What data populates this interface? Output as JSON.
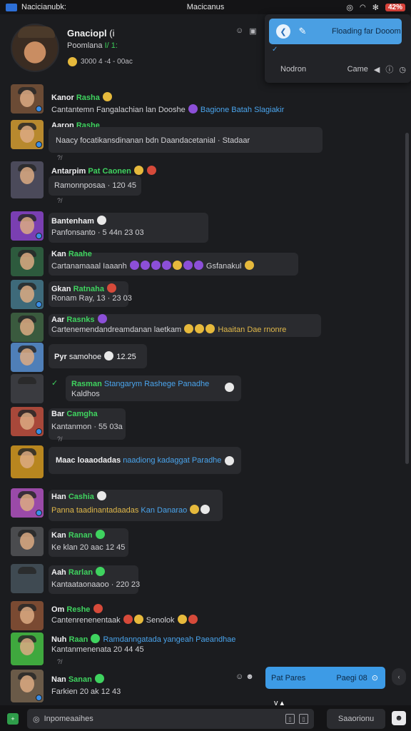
{
  "status": {
    "left_text": "Nacicianubk:",
    "center_text": "Macicanus",
    "battery": "42%"
  },
  "header": {
    "name": "Gnaciopl",
    "name_suffix": "(i",
    "subtitle": "Poomlana",
    "subtitle_status": "I/ 1:",
    "meta": "3000 4 -4 - 00ac"
  },
  "popover": {
    "bar_label": "Floading far Dooom",
    "left_label": "Nodron",
    "right_label": "Came"
  },
  "messages": [
    {
      "name": "Kanor",
      "tag": "Rasha",
      "text": "Cantantemn Fangalachian lan Dooshe",
      "text_accent": "Bagione Batah  Slagiakir"
    },
    {
      "name": "Aaron",
      "tag": "Rashe",
      "text": "Naacy focatikansdinanan bdn Daandacetanial · Stadaar",
      "sub": "?/"
    },
    {
      "name": "Antarpim",
      "tag": "Pat Caonen",
      "text": "Ramonnposaa · 120 45",
      "sub": "?/"
    },
    {
      "name": "Bantenham",
      "tag": "",
      "text": "Panfonsanto · 5 44n 23 03"
    },
    {
      "name": "Kan",
      "tag": "Raahe",
      "text": "Cartanamaaal Iaaanh",
      "text_accent": "Gsfanakul"
    },
    {
      "name": "Gkan",
      "tag": "Ratnaha",
      "text": "Ronam Ray, 13 · 23 03"
    },
    {
      "name": "Aar",
      "tag": "Rasnks",
      "text": "Cartenemendandreamdanan laetkam",
      "text_accent": "Haaitan Dae  rnonre"
    },
    {
      "name": "Pyr",
      "tag": "samohoe",
      "text": "12.25"
    },
    {
      "name": "Rasman",
      "tag": "Stangarym Rashege Panadhe",
      "text": "Kaldhos"
    },
    {
      "name": "Bar",
      "tag": "Camgha",
      "text": "Kantanmon · 55 03a",
      "sub": "?/"
    },
    {
      "name": "Maac",
      "tag": "loaaodadas",
      "text": "",
      "text_accent": "naadiong kadaggat Paradhe"
    },
    {
      "name": "Han",
      "tag": "Cashia",
      "text": "Panna taadinantadaadas",
      "text_accent": "Kan  Danarao"
    },
    {
      "name": "Kan",
      "tag": "Ranan",
      "text": "Ke klan 20 aac 12 45"
    },
    {
      "name": "Aah",
      "tag": "Rarlan",
      "text": "Kantaataonaaoo · 220 23"
    },
    {
      "name": "Om",
      "tag": "Reshe",
      "text": "Cantenrenenentaak",
      "text_accent": "Senolok"
    },
    {
      "name": "Nuh",
      "tag": "Raan",
      "text": "Kantanmenenata 20 44 45",
      "tag2": "Ramdanngatada yangeah Paeandhae",
      "sub": "?/"
    },
    {
      "name": "Nan",
      "tag": "Sanan",
      "text": "Farkien 20 ak 12 43"
    }
  ],
  "pill": {
    "left": "Pat Pares",
    "right": "Paegi 08"
  },
  "composer": {
    "placeholder": "Inpomeaaihes",
    "send_label": "Saaorionu"
  },
  "colors": {
    "accent": "#3d9be6",
    "green": "#3fd35f",
    "background": "#1b1c1f"
  }
}
